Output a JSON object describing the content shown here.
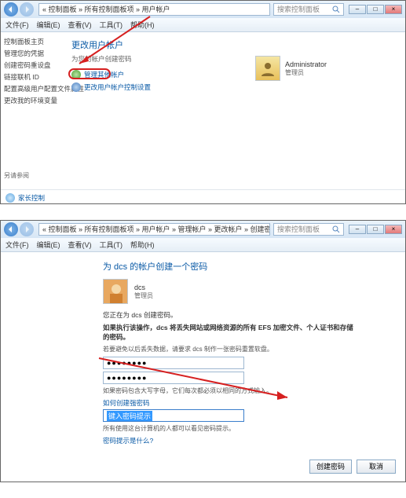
{
  "win1": {
    "breadcrumb": "« 控制面板 » 所有控制面板项 » 用户帐户",
    "search_placeholder": "搜索控制面板",
    "menu": [
      "文件(F)",
      "编辑(E)",
      "查看(V)",
      "工具(T)",
      "帮助(H)"
    ],
    "sidebar": {
      "items": [
        "控制面板主页",
        "管理您的凭据",
        "创建密码重设盘",
        "链接联机 ID",
        "配置高级用户配置文件属性",
        "更改我的环境变量"
      ],
      "seealso_label": "另请参阅",
      "seealso_item": "家长控制"
    },
    "heading": "更改用户帐户",
    "sub": "为您的帐户创建密码",
    "link_manage": "管理其他帐户",
    "link_uac": "更改用户帐户控制设置",
    "user": {
      "name": "Administrator",
      "role": "管理员"
    }
  },
  "win2": {
    "breadcrumb": "« 控制面板 » 所有控制面板项 » 用户帐户 » 管理帐户 » 更改帐户 » 创建密码",
    "search_placeholder": "搜索控制面板",
    "menu": [
      "文件(F)",
      "编辑(E)",
      "查看(V)",
      "工具(T)",
      "帮助(H)"
    ],
    "heading": "为 dcs 的帐户创建一个密码",
    "user": {
      "name": "dcs",
      "role": "管理员"
    },
    "line1": "您正在为 dcs 创建密码。",
    "line2": "如果执行该操作，dcs 将丢失网站或网络资源的所有 EFS 加密文件、个人证书和存储的密码。",
    "line3": "若要避免以后丢失数据，请要求 dcs 制作一张密码重置软盘。",
    "pw1": "●●●●●●●●",
    "pw2": "●●●●●●●●",
    "line4": "如果密码包含大写字母，它们每次都必须以相同的方式输入。",
    "link_help": "如何创建强密码",
    "hint_value": "键入密码提示",
    "line5": "所有使用这台计算机的人都可以看见密码提示。",
    "link_hint": "密码提示是什么?",
    "btn_create": "创建密码",
    "btn_cancel": "取消"
  }
}
